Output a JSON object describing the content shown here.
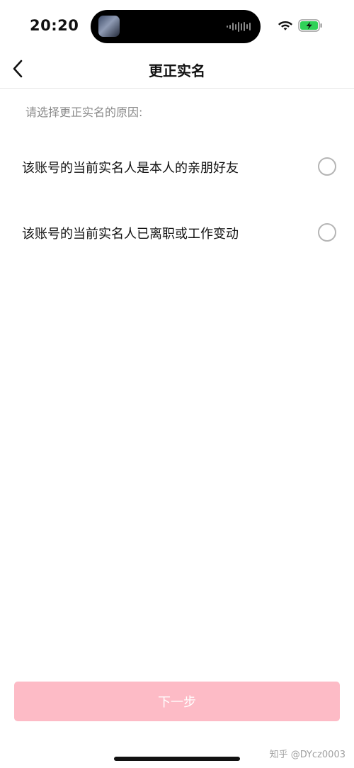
{
  "status_bar": {
    "time": "20:20",
    "icons": [
      "now-playing-art",
      "audio-waveform-icon",
      "wifi-icon",
      "battery-charging-icon"
    ],
    "battery_color": "#30d158"
  },
  "nav": {
    "back_icon": "chevron-left-icon",
    "title": "更正实名"
  },
  "prompt": "请选择更正实名的原因:",
  "options": [
    {
      "label": "该账号的当前实名人是本人的亲朋好友",
      "selected": false
    },
    {
      "label": "该账号的当前实名人已离职或工作变动",
      "selected": false
    }
  ],
  "next_button": {
    "label": "下一步",
    "enabled": false,
    "color": "#fdbbc6"
  },
  "watermark": "知乎 @DYcz0003"
}
